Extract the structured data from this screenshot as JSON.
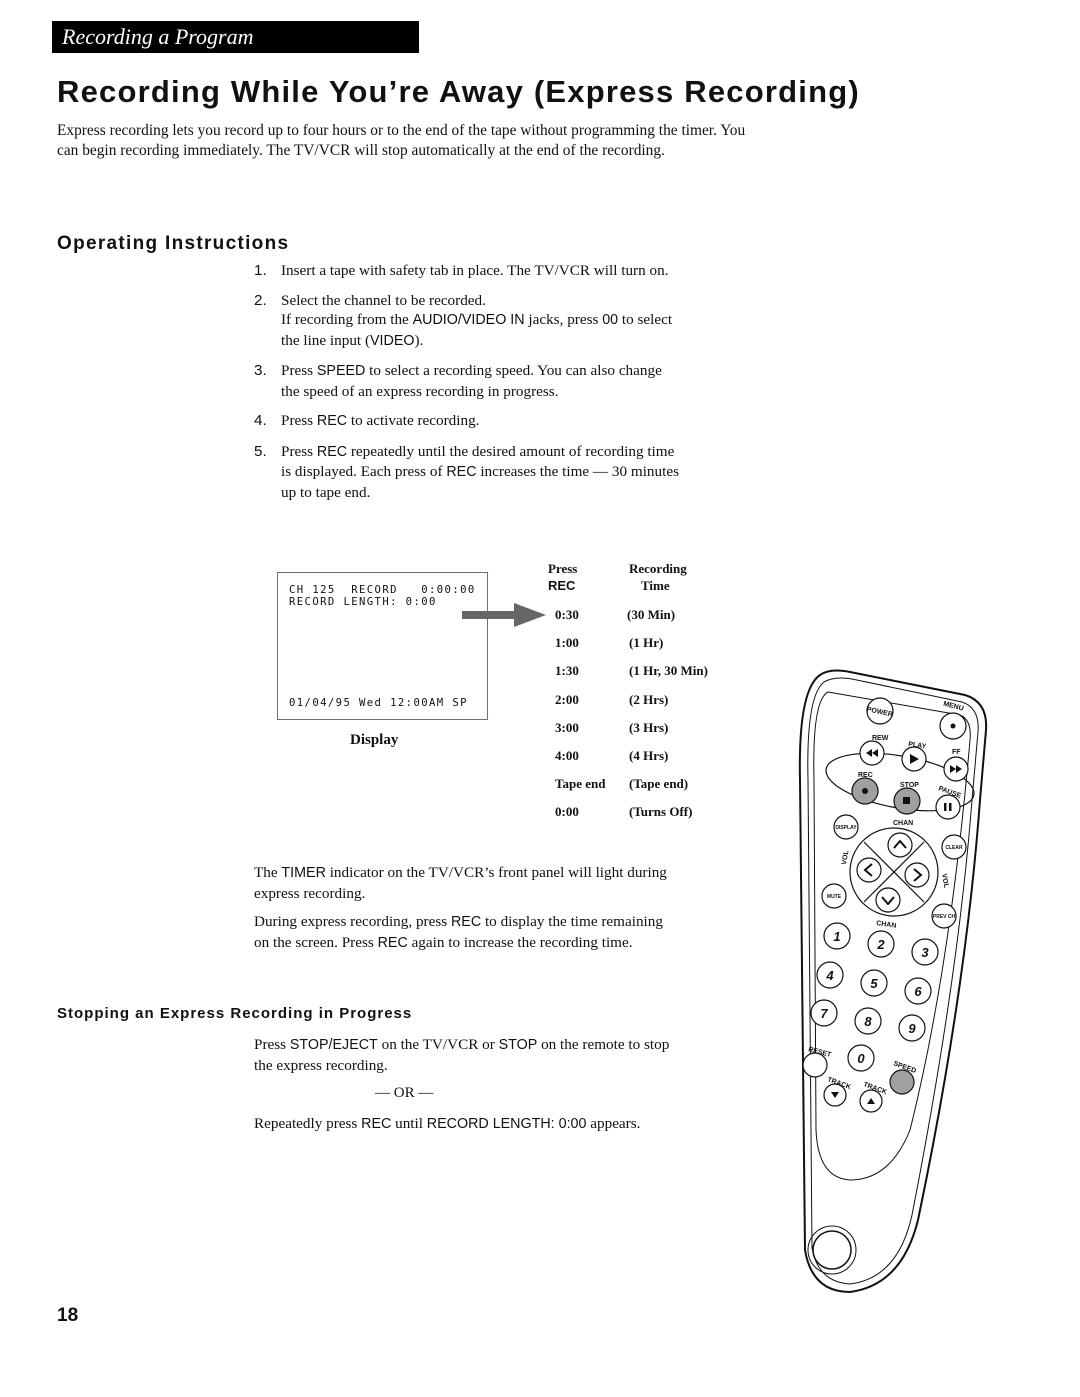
{
  "section_banner": "Recording a Program",
  "page_title": "Recording While You’re Away (Express Recording)",
  "intro": "Express recording lets you record up to four hours or to the end of the tape without programming the timer.  You can begin recording immediately.  The TV/VCR will stop automatically at the end of the recording.",
  "operating": {
    "heading": "Operating Instructions",
    "steps": [
      {
        "num": "1.",
        "parts": [
          {
            "t": "Insert a tape with safety tab in place.  The TV/VCR will turn on."
          }
        ]
      },
      {
        "num": "2.",
        "parts": [
          {
            "t": "Select the channel to be recorded."
          },
          {
            "br": true
          },
          {
            "t": "If recording from the "
          },
          {
            "k": "AUDIO/VIDEO IN"
          },
          {
            "t": " jacks, press "
          },
          {
            "k": "00"
          },
          {
            "t": " to select the line input ("
          },
          {
            "k": "VIDEO"
          },
          {
            "t": ")."
          }
        ]
      },
      {
        "num": "3.",
        "parts": [
          {
            "t": "Press "
          },
          {
            "k": "SPEED"
          },
          {
            "t": " to select a recording speed.  You can also change the speed of an express recording in progress."
          }
        ]
      },
      {
        "num": "4.",
        "parts": [
          {
            "t": "Press "
          },
          {
            "k": "REC"
          },
          {
            "t": " to activate recording."
          }
        ]
      },
      {
        "num": "5.",
        "parts": [
          {
            "t": "Press "
          },
          {
            "k": "REC"
          },
          {
            "t": " repeatedly until the desired amount of recording time is displayed.  Each press of "
          },
          {
            "k": "REC"
          },
          {
            "t": " increases the time — 30 minutes up to tape end."
          }
        ]
      }
    ]
  },
  "display": {
    "line1": "CH 125  RECORD   0:00:00",
    "line2": "RECORD LENGTH: 0:00",
    "line3": "01/04/95 Wed 12:00AM SP",
    "caption": "Display"
  },
  "rec_table": {
    "col1_header_line1": "Press",
    "col1_header_line2": "REC",
    "col2_header_line1": "Recording",
    "col2_header_line2": "Time",
    "rows": [
      {
        "press": "0:30",
        "time": "(30 Min)"
      },
      {
        "press": "1:00",
        "time": "(1 Hr)"
      },
      {
        "press": "1:30",
        "time": "(1 Hr, 30 Min)"
      },
      {
        "press": "2:00",
        "time": "(2 Hrs)"
      },
      {
        "press": "3:00",
        "time": "(3 Hrs)"
      },
      {
        "press": "4:00",
        "time": "(4 Hrs)"
      },
      {
        "press": "Tape end",
        "time": "(Tape end)"
      },
      {
        "press": "0:00",
        "time": "(Turns Off)"
      }
    ]
  },
  "timer_para": [
    {
      "t": "The "
    },
    {
      "k": "TIMER"
    },
    {
      "t": " indicator on the TV/VCR’s front panel will light during express recording."
    }
  ],
  "during_para": [
    {
      "t": "During express recording, press "
    },
    {
      "k": "REC"
    },
    {
      "t": " to display the time remaining on the screen.  Press "
    },
    {
      "k": "REC"
    },
    {
      "t": " again to increase the recording time."
    }
  ],
  "stopping": {
    "heading": "Stopping an Express Recording in Progress",
    "para1": [
      {
        "t": "Press "
      },
      {
        "k": "STOP/EJECT"
      },
      {
        "t": " on the TV/VCR or "
      },
      {
        "k": "STOP"
      },
      {
        "t": " on the remote to stop the express recording."
      }
    ],
    "or_text": "— OR —",
    "para2": [
      {
        "t": "Repeatedly press "
      },
      {
        "k": "REC"
      },
      {
        "t": " until "
      },
      {
        "k": "RECORD LENGTH: 0:00"
      },
      {
        "t": " appears."
      }
    ]
  },
  "remote": {
    "labels": {
      "power": "POWER",
      "menu": "MENU",
      "rew": "REW",
      "play": "PLAY",
      "ff": "FF",
      "rec": "REC",
      "stop": "STOP",
      "pause": "PAUSE",
      "display": "DISPLAY",
      "chan": "CHAN",
      "clear": "CLEAR",
      "vol": "VOL",
      "mute": "MUTE",
      "prev_ch": "PREV CH",
      "reset": "RESET",
      "speed": "SPEED",
      "track": "TRACK"
    },
    "digits": [
      "1",
      "2",
      "3",
      "4",
      "5",
      "6",
      "7",
      "8",
      "9",
      "0"
    ],
    "highlight_color": "#a0a0a0"
  },
  "page_number": "18"
}
